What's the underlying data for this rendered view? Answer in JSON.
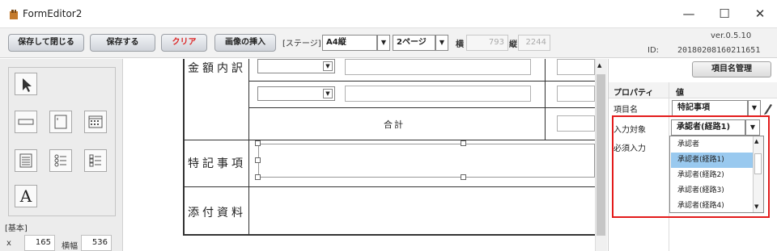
{
  "window": {
    "title": "FormEditor2",
    "minimize": "—",
    "maximize": "☐",
    "close": "✕"
  },
  "toolbar": {
    "save_close": "保存して閉じる",
    "save": "保存する",
    "clear": "クリア",
    "insert_image": "画像の挿入",
    "stage_label": "[ステージ]",
    "paper_size": "A4縦",
    "pages": "2ページ",
    "width_label": "横",
    "width_value": "793",
    "height_label": "縦",
    "height_value": "2244",
    "version": "ver.0.5.10",
    "id_label": "ID:",
    "id_value": "20180208160211651"
  },
  "palette": {
    "section_label": "[基本]",
    "x_label": "x",
    "x_value": "165",
    "width_label": "横幅",
    "width_value": "536",
    "text_tool_glyph": "A"
  },
  "form": {
    "amount_label": "金額内訳",
    "total_label": "合計",
    "notes_label": "特記事項",
    "attachments_label": "添付資料"
  },
  "properties": {
    "manage_button": "項目名管理",
    "col_property": "プロパティ",
    "col_value": "値",
    "rows": [
      {
        "label": "項目名",
        "value": "特記事項"
      },
      {
        "label": "入力対象",
        "value": "承認者(経路1)"
      },
      {
        "label": "必須入力",
        "value": ""
      }
    ],
    "dropdown_options": [
      "承認者",
      "承認者(経路1)",
      "承認者(経路2)",
      "承認者(経路3)",
      "承認者(経路4)"
    ],
    "dropdown_selected": "承認者(経路1)"
  },
  "colors": {
    "highlight_frame": "#e31b1b",
    "selected_option": "#99c9ef",
    "clear_text": "#dd2222"
  }
}
